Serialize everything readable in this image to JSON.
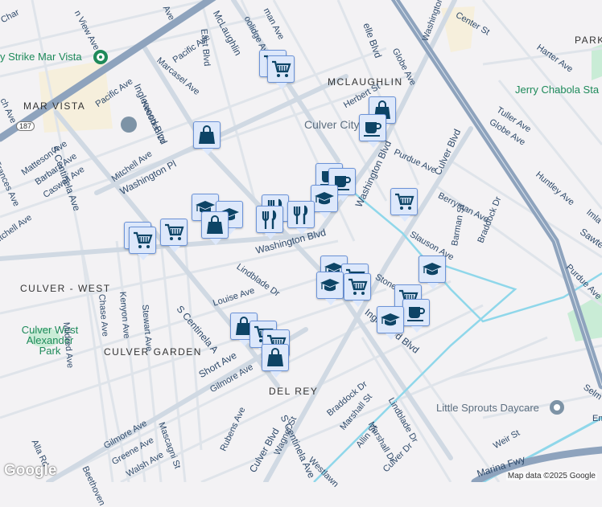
{
  "neighborhoods": {
    "mar_vista": "MAR VISTA",
    "mclaughlin": "MCLAUGHLIN",
    "culver_west": "CULVER - WEST",
    "culver_garden": "CULVER GARDEN",
    "del_rey": "DEL REY",
    "park": "PARK"
  },
  "city": "Culver City",
  "pois": {
    "strike": "y Strike Mar Vista",
    "jerry": "Jerry Chabola Sta",
    "alexander_park": "Culver West Alexander Park",
    "little_sprouts": "Little Sprouts Daycare"
  },
  "highway_shield": "187",
  "streets": {
    "chan": "Char",
    "view": "n View Ave",
    "ave_top": "Ave",
    "mclaughlin": "McLaughlin",
    "coolidge": "oolidge Ave",
    "man": "man Ave",
    "east_blvd": "East Blvd",
    "pacific1": "Pacific Ave",
    "pacific2": "Pacific Ave",
    "marcasel": "Marcasel Ave",
    "inglewood": "Inglewood Blvd",
    "keeshen": "Keeshen Dr",
    "s_centinela": "S Centinela Ave",
    "matteson": "Matteson Ave",
    "barbara": "Barbara Ave",
    "caswell": "Caswell Ave",
    "mitchell": "Mitchell Ave",
    "washington_pl": "Washington Pl",
    "frances": "Frances Ave",
    "ch_ave": "ch Ave",
    "mitchell2": "itchell Ave",
    "belle": "elle Blvd",
    "globe": "Globe Ave",
    "washington_top": "Washington",
    "center": "Center St",
    "harter": "Harter Ave",
    "herbert": "Herbert St",
    "tuller": "Tuller Ave",
    "globe2": "Globe Ave",
    "purdue": "Purdue Ave",
    "washington_blvd": "Washington Blvd",
    "washington_blvd2": "Washington Blvd",
    "culver_blvd": "Culver Blvd",
    "huntley": "Huntley Ave",
    "berryman": "Berryman Ave",
    "barman": "Barman St",
    "braddock": "Braddock Dr",
    "slauson": "Slauson Ave",
    "imla": "Imla",
    "sawte": "Sawte",
    "purdue2": "Purdue Ave",
    "lindblade": "Lindblade Dr",
    "louise": "Louise Ave",
    "chase": "Chase Ave",
    "kenyon": "Kenyon Ave",
    "stewart": "Stewart Ave",
    "mildred": "Mildred Ave",
    "s_centinela2": "S Centinela A",
    "short": "Short Ave",
    "gilmore": "Gilmore Ave",
    "gilmore2": "Gilmore Ave",
    "greene": "Greene Ave",
    "walsh": "Walsh Ave",
    "beethoven": "Beethoven",
    "alla": "Alla Rd",
    "mascagni": "Mascagni St",
    "rubens": "Rubens Ave",
    "culver_blvd2": "Culver Blvd",
    "wagner": "Wagner St",
    "s_centinela3": "S Centinela Ave",
    "braddock2": "Braddock Dr",
    "marshall": "Marshall St",
    "marshall2": "Marshall Dr",
    "allin": "Allin St",
    "lindblade2": "Lindblade Dr",
    "culver_dr": "Culver Dr",
    "westlawn": "Westlawn",
    "stone": "Stone",
    "inglewood2": "Inglewood Blvd",
    "weir": "Weir St",
    "selma": "Selm",
    "em": "Em",
    "marina": "Marina Fwy",
    "lane_st": "St",
    "rd_st": "e St",
    "lost": "St",
    "blvd": "lvd"
  },
  "attribution": "Map data ©2025 Google",
  "google_logo": "Google",
  "colors": {
    "road": "#d3dce6",
    "freeway": "#8ea3bd",
    "water": "#8fd7ea",
    "park": "#c9ecd6",
    "marker_bg": "#dde8fb",
    "marker_icon": "#0d4466"
  }
}
